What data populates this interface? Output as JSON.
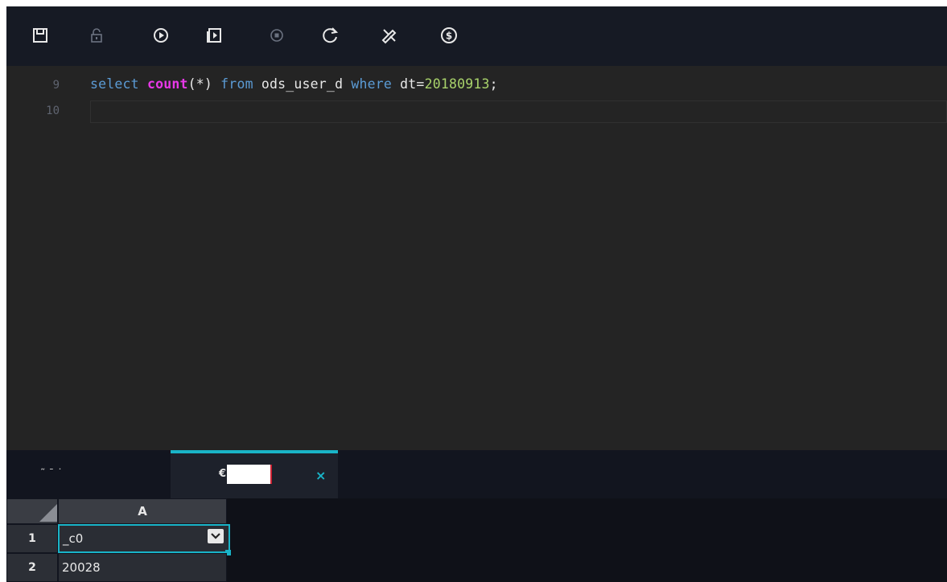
{
  "toolbar": {
    "buttons": [
      {
        "icon": "save-icon"
      },
      {
        "icon": "lock-icon"
      },
      {
        "icon": "run-icon"
      },
      {
        "icon": "run-with-params-icon"
      },
      {
        "icon": "stop-icon"
      },
      {
        "icon": "reload-icon"
      },
      {
        "icon": "format-icon"
      },
      {
        "icon": "cost-estimate-icon"
      }
    ]
  },
  "editor": {
    "lines": [
      {
        "number": "9",
        "tokens": {
          "t1": "select",
          "t2": "count",
          "t3": "(*)",
          "t4": "from",
          "t5": "ods_user_d",
          "t6": "where",
          "t7": "dt=",
          "t8": "20180913",
          "t9": ";"
        }
      },
      {
        "number": "10"
      }
    ]
  },
  "results": {
    "tabs": [
      {
        "label": "˜ ˉ ˙"
      },
      {
        "label": "€|",
        "close": "×"
      }
    ],
    "grid": {
      "column_header": "A",
      "rows": [
        {
          "num": "1",
          "value": "_c0"
        },
        {
          "num": "2",
          "value": "20028"
        }
      ]
    }
  },
  "colors": {
    "accent": "#19b4c8",
    "keyword": "#5b9bd5",
    "function": "#e838e8",
    "number": "#a9d36b"
  }
}
